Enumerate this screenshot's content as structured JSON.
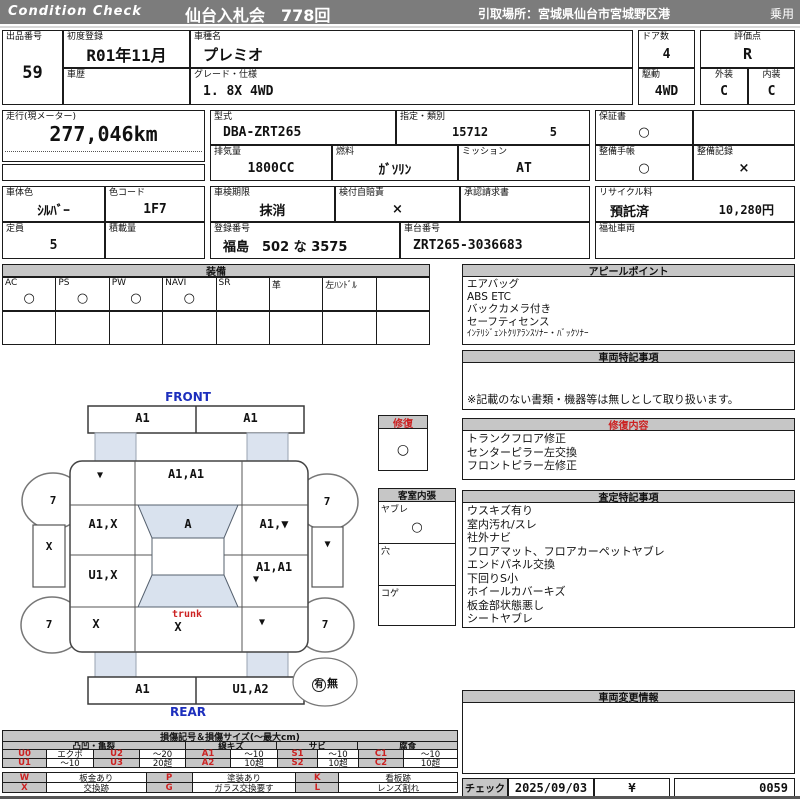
{
  "header": {
    "brand": "Condition  Check",
    "auction": "仙台入札会　778回",
    "pickup": "引取場所：宮城県仙台市宮城野区港",
    "category": "乗用"
  },
  "fields": {
    "lot": {
      "label": "出品番号",
      "value": "59"
    },
    "first_reg": {
      "label": "初度登録",
      "value": "R01年11月"
    },
    "history": {
      "label": "車歴",
      "value": ""
    },
    "model": {
      "label": "車種名",
      "value": "プレミオ"
    },
    "grade": {
      "label": "グレード・仕様",
      "value": "1. 8X  4WD"
    },
    "doors": {
      "label": "ドア数",
      "value": "4"
    },
    "drive": {
      "label": "駆動",
      "value": "4WD"
    },
    "score": {
      "label": "評価点",
      "value": "R"
    },
    "exterior": {
      "label": "外装",
      "value": "C"
    },
    "interior": {
      "label": "内装",
      "value": "C"
    },
    "mileage": {
      "label": "走行(現メーター)",
      "value": "277,046km"
    },
    "model_code": {
      "label": "型式",
      "value": "DBA-ZRT265"
    },
    "class": {
      "label": "指定・類別",
      "value1": "15712",
      "value2": "5"
    },
    "displacement": {
      "label": "排気量",
      "value": "1800CC"
    },
    "fuel": {
      "label": "燃料",
      "value": "ｶﾞｿﾘﾝ"
    },
    "mission": {
      "label": "ミッション",
      "value": "AT"
    },
    "warranty": {
      "label": "保証書",
      "value": "○"
    },
    "maintenance_book": {
      "label": "整備手帳",
      "value": "○"
    },
    "maintenance_record": {
      "label": "整備記録",
      "value": "×"
    },
    "body_color": {
      "label": "車体色",
      "value": "ｼﾙﾊﾞｰ"
    },
    "color_code": {
      "label": "色コード",
      "value": "1F7"
    },
    "inspection": {
      "label": "車検期限",
      "value": "抹消"
    },
    "insurance": {
      "label": "検付自賠責",
      "value": "×"
    },
    "approval": {
      "label": "承認請求書",
      "value": ""
    },
    "recycle": {
      "label": "リサイクル料",
      "status": "預託済",
      "fee": "10,280円"
    },
    "capacity": {
      "label": "定員",
      "value": "5"
    },
    "load": {
      "label": "積載量",
      "value": ""
    },
    "reg_no": {
      "label": "登録番号",
      "value": "福島　502 な 3575"
    },
    "chassis": {
      "label": "車台番号",
      "value": "ZRT265-3036683"
    },
    "welfare": {
      "label": "福祉車両",
      "value": ""
    }
  },
  "equipment": {
    "title": "装備",
    "items": [
      {
        "label": "AC",
        "value": "○"
      },
      {
        "label": "PS",
        "value": "○"
      },
      {
        "label": "PW",
        "value": "○"
      },
      {
        "label": "NAVI",
        "value": "○"
      },
      {
        "label": "SR",
        "value": ""
      },
      {
        "label": "革",
        "value": ""
      },
      {
        "label": "左ﾊﾝﾄﾞﾙ",
        "value": ""
      },
      {
        "label": "",
        "value": ""
      }
    ]
  },
  "appeal": {
    "title": "アピールポイント",
    "lines": [
      "エアバッグ",
      "ABS ETC",
      "バックカメラ付き",
      "セーフティセンス",
      "ｲﾝﾃﾘｼﾞｪﾝﾄｸﾘｱﾗﾝｽｿﾅｰ・ﾊﾞｯｸｿﾅｰ"
    ]
  },
  "vehicle_notes": {
    "title": "車両特記事項",
    "note": "※記載のない書類・機器等は無しとして取り扱います。"
  },
  "repair": {
    "label": "修復",
    "mark": "○",
    "content_title": "修復内容",
    "lines": [
      "トランクフロア修正",
      "センターピラー左交換",
      "フロントピラー左修正"
    ]
  },
  "cabin": {
    "title": "客室内張",
    "items": [
      {
        "label": "ヤブレ",
        "value": "○"
      },
      {
        "label": "穴",
        "value": ""
      },
      {
        "label": "コゲ",
        "value": ""
      }
    ]
  },
  "assessment": {
    "title": "査定特記事項",
    "lines": [
      "ウスキズ有り",
      "室内汚れ/スレ",
      "社外ナビ",
      "フロアマット、フロアカーペットヤブレ",
      "エンドパネル交換",
      "下回りS小",
      "ホイールカバーキズ",
      "板金部状態悪し",
      "シートヤブレ"
    ]
  },
  "change_info": {
    "title": "車両変更情報"
  },
  "check": {
    "label": "チェック",
    "date": "2025/09/03",
    "inspector": "¥",
    "sheet_no": "0059"
  },
  "diagram": {
    "front_label": "FRONT",
    "rear_label": "REAR",
    "front_bumper_left": "A1",
    "front_bumper_right": "A1",
    "hood_left": "▼",
    "hood_center": "A1,A1",
    "windshield": "A",
    "front_door_left": "A1,X",
    "front_door_right": "A1,▼",
    "side_left": "X",
    "side_right": "▼",
    "rear_door_left": "U1,X",
    "rear_door_right": "A1,A1",
    "rear_door_right_extra": "▼",
    "quarter_left": "X",
    "quarter_right": "▼",
    "trunk_label": "trunk",
    "trunk_mark": "X",
    "rear_bumper_left": "A1",
    "rear_bumper_right": "U1,A2",
    "tires": [
      "7",
      "7",
      "7",
      "7"
    ],
    "spare_yes": "有",
    "spare_no": "無"
  },
  "legend": {
    "title": "損傷記号＆損傷サイズ(〜最大cm)",
    "groups": [
      "凸凹・亀裂",
      "線キズ",
      "サビ",
      "腐食"
    ],
    "rows": [
      [
        "U0",
        "エクボ",
        "U2",
        "〜20",
        "A1",
        "〜10",
        "S1",
        "〜10",
        "C1",
        "〜10"
      ],
      [
        "U1",
        "〜10",
        "U3",
        "20超",
        "A2",
        "10超",
        "S2",
        "10超",
        "C2",
        "10超"
      ]
    ],
    "marks": [
      [
        "W",
        "板金あり",
        "P",
        "塗装あり",
        "K",
        "看板跡"
      ],
      [
        "X",
        "交換跡",
        "G",
        "ガラス交換要す",
        "L",
        "レンズ割れ"
      ]
    ]
  }
}
